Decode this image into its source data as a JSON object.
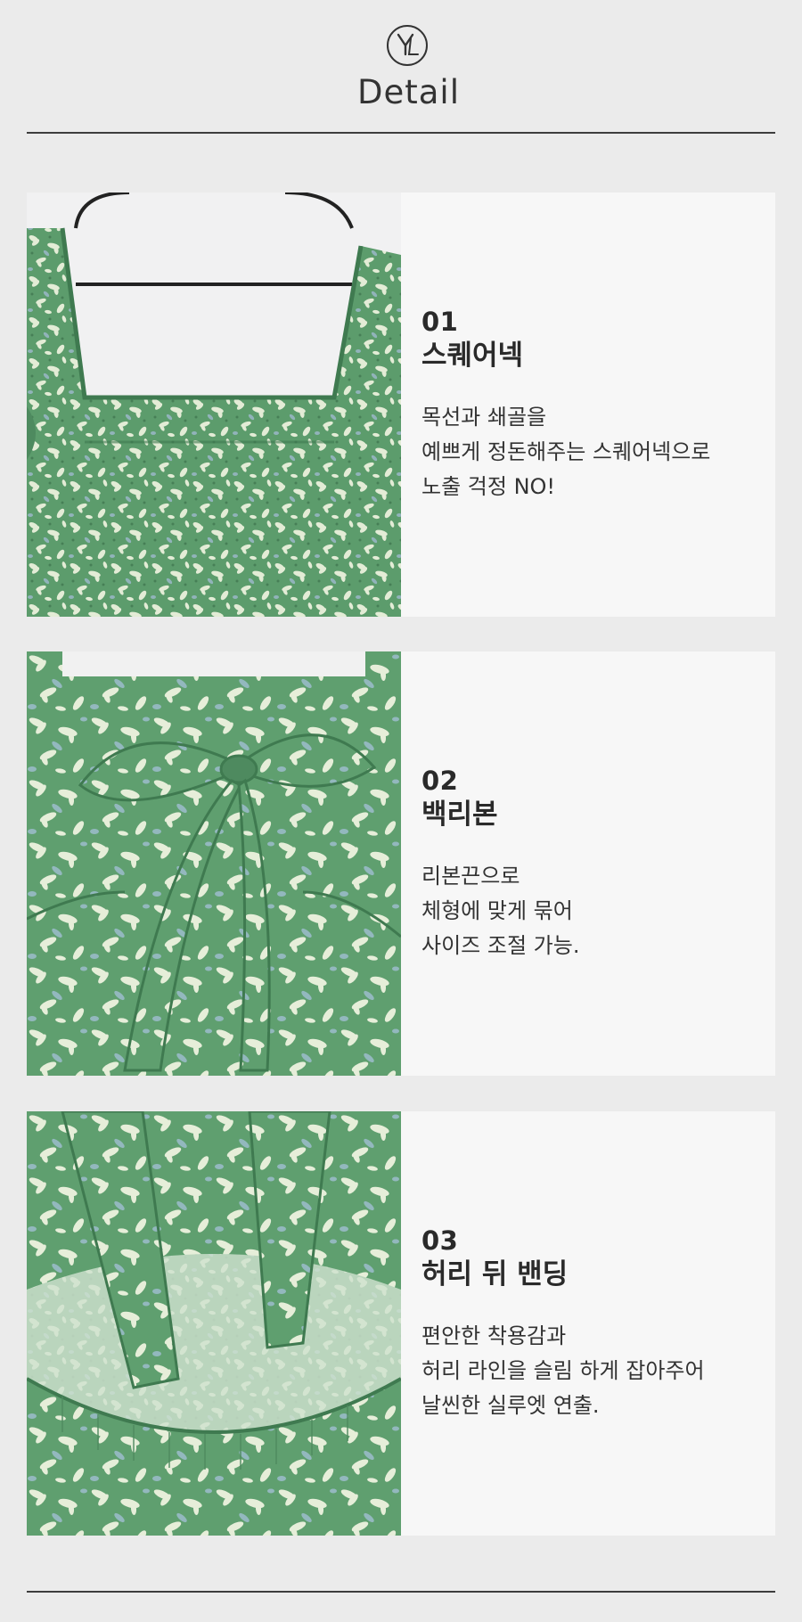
{
  "header": {
    "logo_icon": "yl-monogram-logo",
    "title": "Detail"
  },
  "details": [
    {
      "number": "01",
      "heading": "스퀘어넥",
      "lines": [
        "목선과 쇄골을",
        "예쁘게 정돈해주는 스퀘어넥으로",
        "노출 걱정 NO!"
      ]
    },
    {
      "number": "02",
      "heading": "백리본",
      "lines": [
        "리본끈으로",
        "체형에 맞게 묶어",
        "사이즈 조절 가능."
      ]
    },
    {
      "number": "03",
      "heading": "허리 뒤 밴딩",
      "lines": [
        "편안한 착용감과",
        "허리 라인을 슬림 하게 잡아주어",
        "날씬한 실루엣 연출."
      ]
    }
  ],
  "colors": {
    "background": "#ebebeb",
    "card": "#f7f7f7",
    "fabric_green": "#5c9c6c",
    "fabric_flower": "#e3ecd6",
    "fabric_blue": "#9ab8c8"
  }
}
